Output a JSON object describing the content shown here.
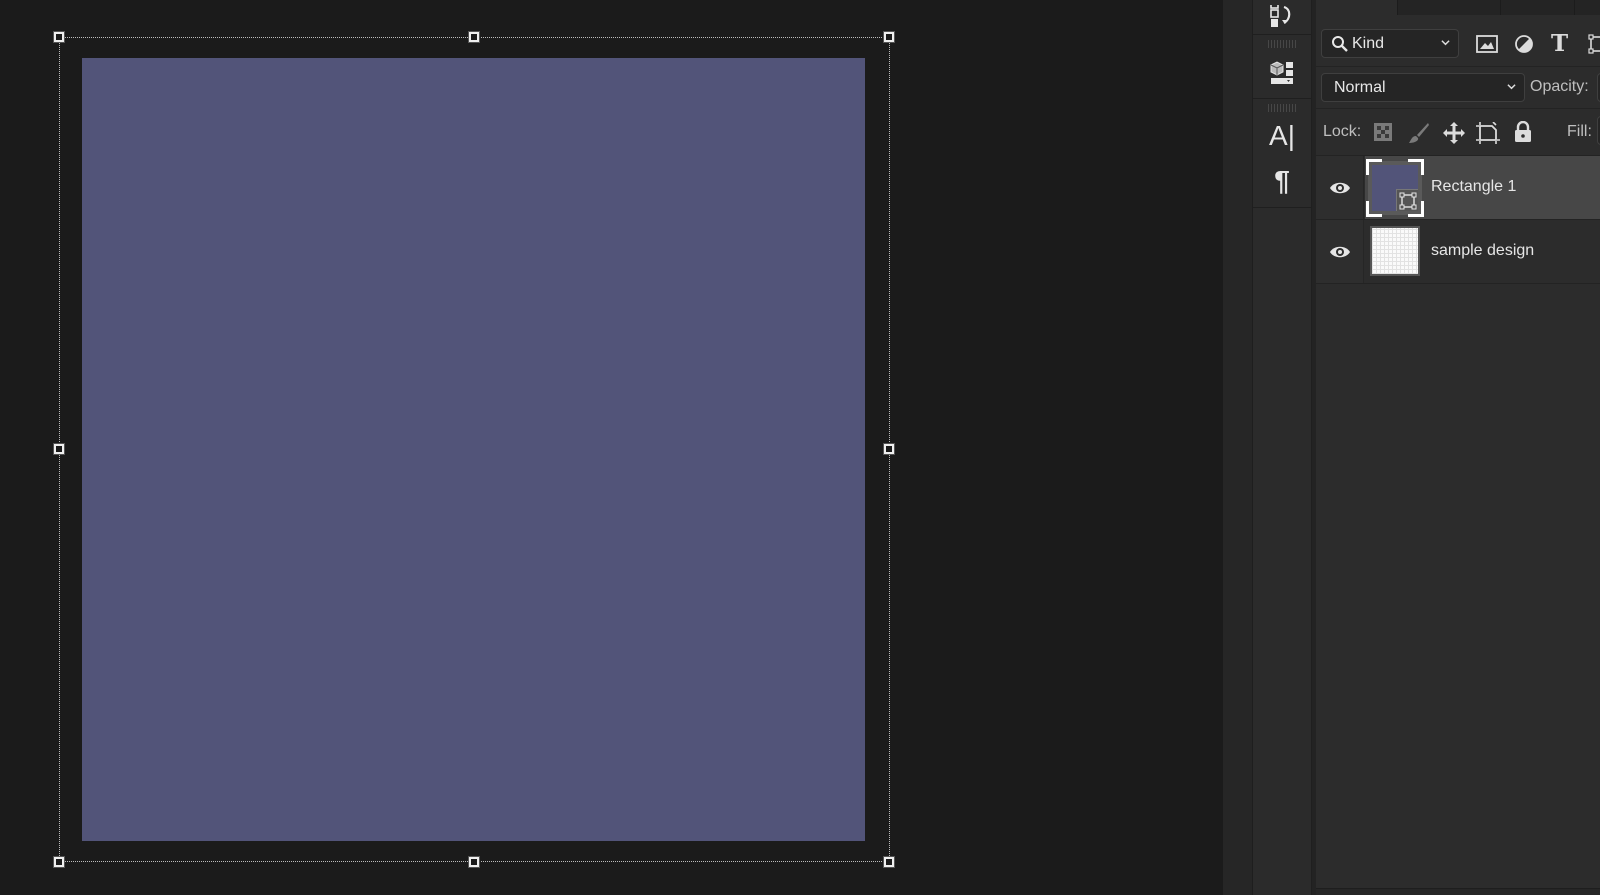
{
  "canvas": {
    "shape_fill": "#525479",
    "selection": "transform-bounding-box"
  },
  "toolbar_icons": [
    {
      "name": "history-icon"
    },
    {
      "name": "3d-properties-icon"
    },
    {
      "name": "character-icon",
      "glyph": "A|"
    },
    {
      "name": "paragraph-icon",
      "glyph": "¶"
    }
  ],
  "layers_panel": {
    "filter": {
      "icon": "search-icon",
      "value": "Kind",
      "filter_icons": [
        "pixel-layer-filter-icon",
        "adjustment-layer-filter-icon",
        "type-layer-filter-icon",
        "shape-layer-filter-icon"
      ],
      "type_glyph": "T"
    },
    "blend_mode": {
      "value": "Normal"
    },
    "opacity_label": "Opacity:",
    "lock_label": "Lock:",
    "lock_icons": [
      "lock-transparent-pixels-icon",
      "lock-image-pixels-icon",
      "lock-position-icon",
      "lock-artboard-icon",
      "lock-all-icon"
    ],
    "fill_label": "Fill:",
    "layers": [
      {
        "name": "Rectangle 1",
        "visible": true,
        "selected": true,
        "thumb_color": "#525479",
        "type": "shape"
      },
      {
        "name": "sample design",
        "visible": true,
        "selected": false,
        "type": "pixel"
      }
    ]
  }
}
